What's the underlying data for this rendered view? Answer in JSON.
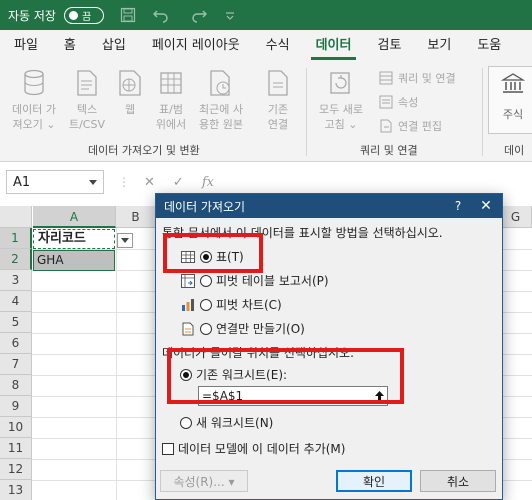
{
  "titlebar": {
    "autosave_label": "자동 저장",
    "toggle_state": "끔"
  },
  "menu": {
    "tabs": [
      "파일",
      "홈",
      "삽입",
      "페이지 레이아웃",
      "수식",
      "데이터",
      "검토",
      "보기",
      "도움"
    ],
    "active": "데이터"
  },
  "ribbon": {
    "get_data": {
      "line1": "데이터 가",
      "line2": "져오기 ⌄"
    },
    "text_csv": {
      "line1": "텍스",
      "line2": "트/CSV"
    },
    "web": {
      "line1": "웹"
    },
    "table_range": {
      "line1": "표/범",
      "line2": "위에서"
    },
    "recent_sources": {
      "line1": "최근에 사",
      "line2": "용한 원본"
    },
    "existing_connections": {
      "line1": "기존",
      "line2": "연결"
    },
    "group_get_transform": "데이터 가져오기 및 변환",
    "refresh_all": {
      "line1": "모두 새로",
      "line2": "고침 ⌄"
    },
    "queries_connections": "쿼리 및 연결",
    "properties": "속성",
    "edit_links": "연결 편집",
    "group_queries": "쿼리 및 연결",
    "stocks": "주식",
    "group_data_types_partial": "데이"
  },
  "formula_bar": {
    "namebox": "A1",
    "cancel": "✕",
    "enter": "✓",
    "fx": "fx"
  },
  "sheet": {
    "columns": [
      "A",
      "B",
      "G"
    ],
    "rows": [
      "1",
      "2",
      "3",
      "4",
      "5",
      "6",
      "7",
      "8",
      "9",
      "10",
      "11",
      "12",
      "13"
    ],
    "a1": "자리코드",
    "a2": "GHA"
  },
  "dialog": {
    "title": "데이터 가져오기",
    "help": "?",
    "close": "✕",
    "prompt_view": "통합 문서에서 이 데이터를 표시할 방법을 선택하십시오.",
    "option_table": "표(T)",
    "option_pivot_table": "피벗 테이블 보고서(P)",
    "option_pivot_chart": "피벗 차트(C)",
    "option_connection_only": "연결만 만들기(O)",
    "prompt_location": "데이터가 들어갈 위치를 선택하십시오.",
    "option_existing_sheet": "기존 워크시트(E):",
    "reference_value": "=$A$1",
    "option_new_sheet": "새 워크시트(N)",
    "add_to_data_model": "데이터 모델에 이 데이터 추가(M)",
    "properties_button": "속성(R)... ▾",
    "ok_button": "확인",
    "cancel_button": "취소"
  },
  "colors": {
    "excel_green": "#217346",
    "dialog_title": "#1e4e79",
    "annotation_red": "#e21a1a"
  }
}
